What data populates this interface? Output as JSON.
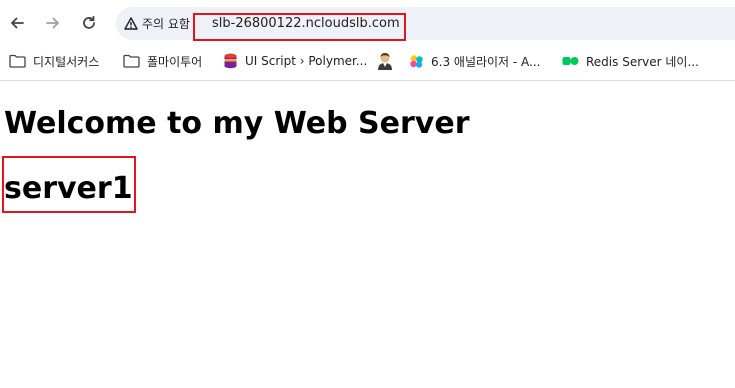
{
  "browser": {
    "security_chip": "주의 요함",
    "url": "slb-26800122.ncloudslb.com"
  },
  "bookmarks": [
    {
      "label": "디지털서커스",
      "icon": "folder-icon"
    },
    {
      "label": "폴마이투어",
      "icon": "folder-icon"
    },
    {
      "label": "UI Script › Polymer...",
      "icon": "database-icon"
    },
    {
      "label": "",
      "icon": "avatar-icon"
    },
    {
      "label": "6.3 애널라이저 - A...",
      "icon": "elastic-icon"
    },
    {
      "label": "Redis Server 네이...",
      "icon": "ncloud-icon"
    }
  ],
  "page": {
    "heading": "Welcome to my Web Server",
    "server_name": "server1"
  },
  "colors": {
    "highlight": "#e3141b",
    "omnibox_bg": "#eef1f7"
  }
}
